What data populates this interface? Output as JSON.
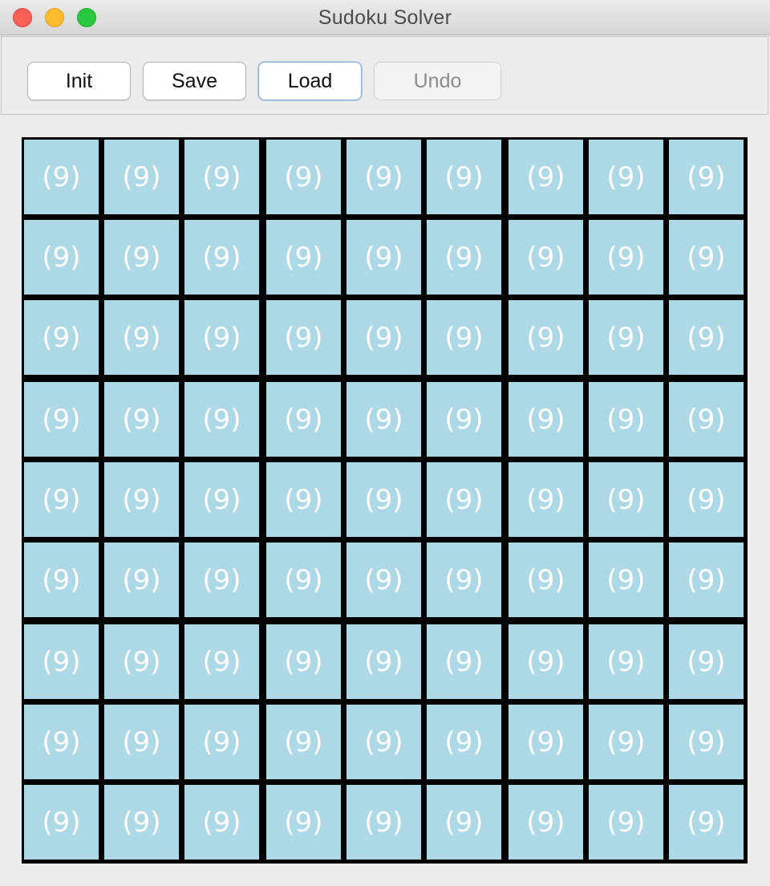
{
  "window": {
    "title": "Sudoku Solver"
  },
  "toolbar": {
    "init_label": "Init",
    "save_label": "Save",
    "load_label": "Load",
    "undo_label": "Undo",
    "undo_enabled": false
  },
  "board": {
    "cell_color": "#add8e6",
    "grid_color": "#000000",
    "text_color": "#ffffff",
    "rows": [
      [
        "(9)",
        "(9)",
        "(9)",
        "(9)",
        "(9)",
        "(9)",
        "(9)",
        "(9)",
        "(9)"
      ],
      [
        "(9)",
        "(9)",
        "(9)",
        "(9)",
        "(9)",
        "(9)",
        "(9)",
        "(9)",
        "(9)"
      ],
      [
        "(9)",
        "(9)",
        "(9)",
        "(9)",
        "(9)",
        "(9)",
        "(9)",
        "(9)",
        "(9)"
      ],
      [
        "(9)",
        "(9)",
        "(9)",
        "(9)",
        "(9)",
        "(9)",
        "(9)",
        "(9)",
        "(9)"
      ],
      [
        "(9)",
        "(9)",
        "(9)",
        "(9)",
        "(9)",
        "(9)",
        "(9)",
        "(9)",
        "(9)"
      ],
      [
        "(9)",
        "(9)",
        "(9)",
        "(9)",
        "(9)",
        "(9)",
        "(9)",
        "(9)",
        "(9)"
      ],
      [
        "(9)",
        "(9)",
        "(9)",
        "(9)",
        "(9)",
        "(9)",
        "(9)",
        "(9)",
        "(9)"
      ],
      [
        "(9)",
        "(9)",
        "(9)",
        "(9)",
        "(9)",
        "(9)",
        "(9)",
        "(9)",
        "(9)"
      ],
      [
        "(9)",
        "(9)",
        "(9)",
        "(9)",
        "(9)",
        "(9)",
        "(9)",
        "(9)",
        "(9)"
      ]
    ]
  }
}
